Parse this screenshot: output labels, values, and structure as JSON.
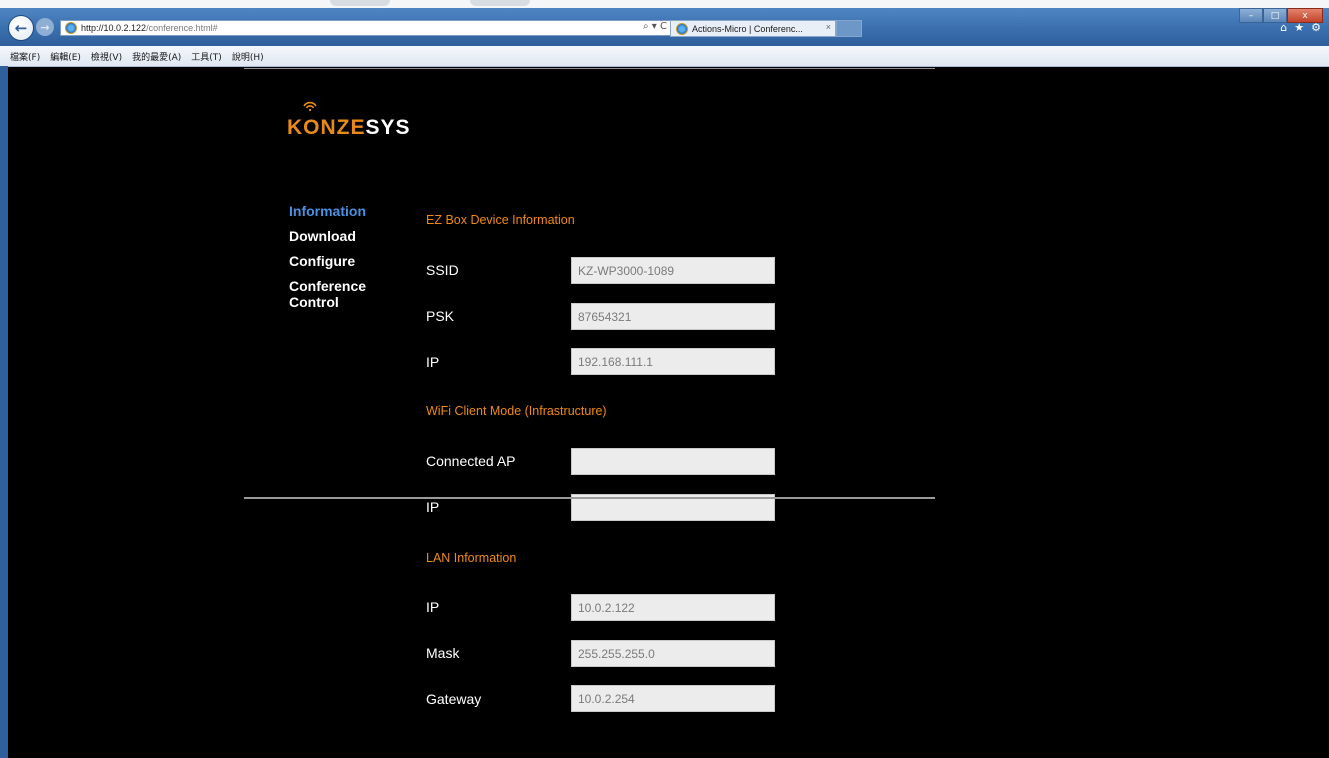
{
  "browser": {
    "url_host": "http://10.0.2.122",
    "url_path": "/conference.html#",
    "address_tools": "⌕ ▾ C",
    "tab_title": "Actions-Micro | Conferenc...",
    "tab_close": "×",
    "window_controls": {
      "minimize": "–",
      "maximize": "□",
      "close": "x"
    },
    "toolbar_icons": {
      "home": "⌂",
      "favorites": "★",
      "tools": "⚙"
    },
    "nav": {
      "back": "←",
      "forward": "→"
    }
  },
  "menubar": {
    "items": [
      "檔案(F)",
      "編輯(E)",
      "檢視(V)",
      "我的最愛(A)",
      "工具(T)",
      "說明(H)"
    ]
  },
  "logo": {
    "part1": "KONZE",
    "part2": "SYS"
  },
  "sidebar": {
    "items": [
      {
        "label": "Information",
        "active": true
      },
      {
        "label": "Download",
        "active": false
      },
      {
        "label": "Configure",
        "active": false
      },
      {
        "label": "Conference Control",
        "active": false
      }
    ]
  },
  "device_info": {
    "title": "EZ Box Device Information",
    "ssid_label": "SSID",
    "ssid_value": "KZ-WP3000-1089",
    "psk_label": "PSK",
    "psk_value": "87654321",
    "ip_label": "IP",
    "ip_value": "192.168.111.1"
  },
  "wifi_client": {
    "title": "WiFi Client Mode (Infrastructure)",
    "ap_label": "Connected AP",
    "ap_value": "",
    "ip_label": "IP",
    "ip_value": ""
  },
  "lan": {
    "title": "LAN Information",
    "ip_label": "IP",
    "ip_value": "10.0.2.122",
    "mask_label": "Mask",
    "mask_value": "255.255.255.0",
    "gateway_label": "Gateway",
    "gateway_value": "10.0.2.254"
  },
  "colors": {
    "accent_orange": "#ef8a14",
    "active_blue": "#4a90e2",
    "background": "#000000"
  }
}
